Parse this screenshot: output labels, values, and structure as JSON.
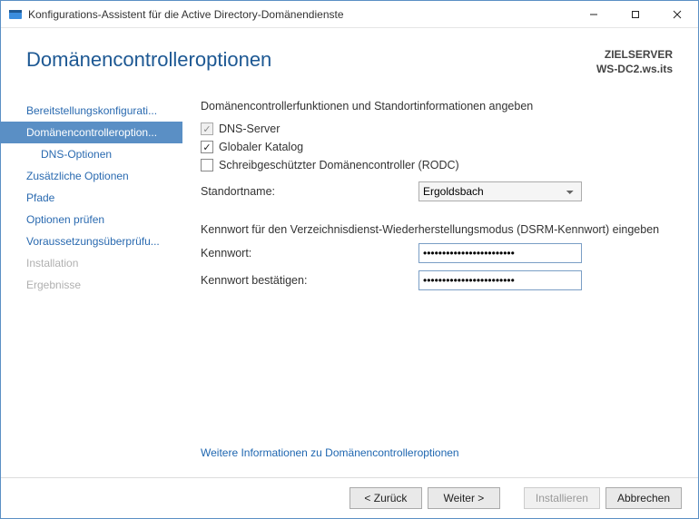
{
  "window_title": "Konfigurations-Assistent für die Active Directory-Domänendienste",
  "header": {
    "title": "Domänencontrolleroptionen",
    "target_label": "ZIELSERVER",
    "target_value": "WS-DC2.ws.its"
  },
  "nav": {
    "items": [
      {
        "label": "Bereitstellungskonfigurati...",
        "state": "normal"
      },
      {
        "label": "Domänencontrolleroption...",
        "state": "selected"
      },
      {
        "label": "DNS-Optionen",
        "state": "sub"
      },
      {
        "label": "Zusätzliche Optionen",
        "state": "normal"
      },
      {
        "label": "Pfade",
        "state": "normal"
      },
      {
        "label": "Optionen prüfen",
        "state": "normal"
      },
      {
        "label": "Voraussetzungsüberprüfu...",
        "state": "normal"
      },
      {
        "label": "Installation",
        "state": "disabled"
      },
      {
        "label": "Ergebnisse",
        "state": "disabled"
      }
    ]
  },
  "content": {
    "heading": "Domänencontrollerfunktionen und Standortinformationen angeben",
    "chk_dns": "DNS-Server",
    "chk_gc": "Globaler Katalog",
    "chk_rodc": "Schreibgeschützter Domänencontroller (RODC)",
    "site_label": "Standortname:",
    "site_value": "Ergoldsbach",
    "pw_heading": "Kennwort für den Verzeichnisdienst-Wiederherstellungsmodus (DSRM-Kennwort) eingeben",
    "pw_label": "Kennwort:",
    "pw_confirm_label": "Kennwort bestätigen:",
    "pw_value": "••••••••••••••••••••••••",
    "pw_confirm_value": "••••••••••••••••••••••••",
    "more_link": "Weitere Informationen zu Domänencontrolleroptionen"
  },
  "footer": {
    "back": "< Zurück",
    "next": "Weiter >",
    "install": "Installieren",
    "cancel": "Abbrechen"
  }
}
